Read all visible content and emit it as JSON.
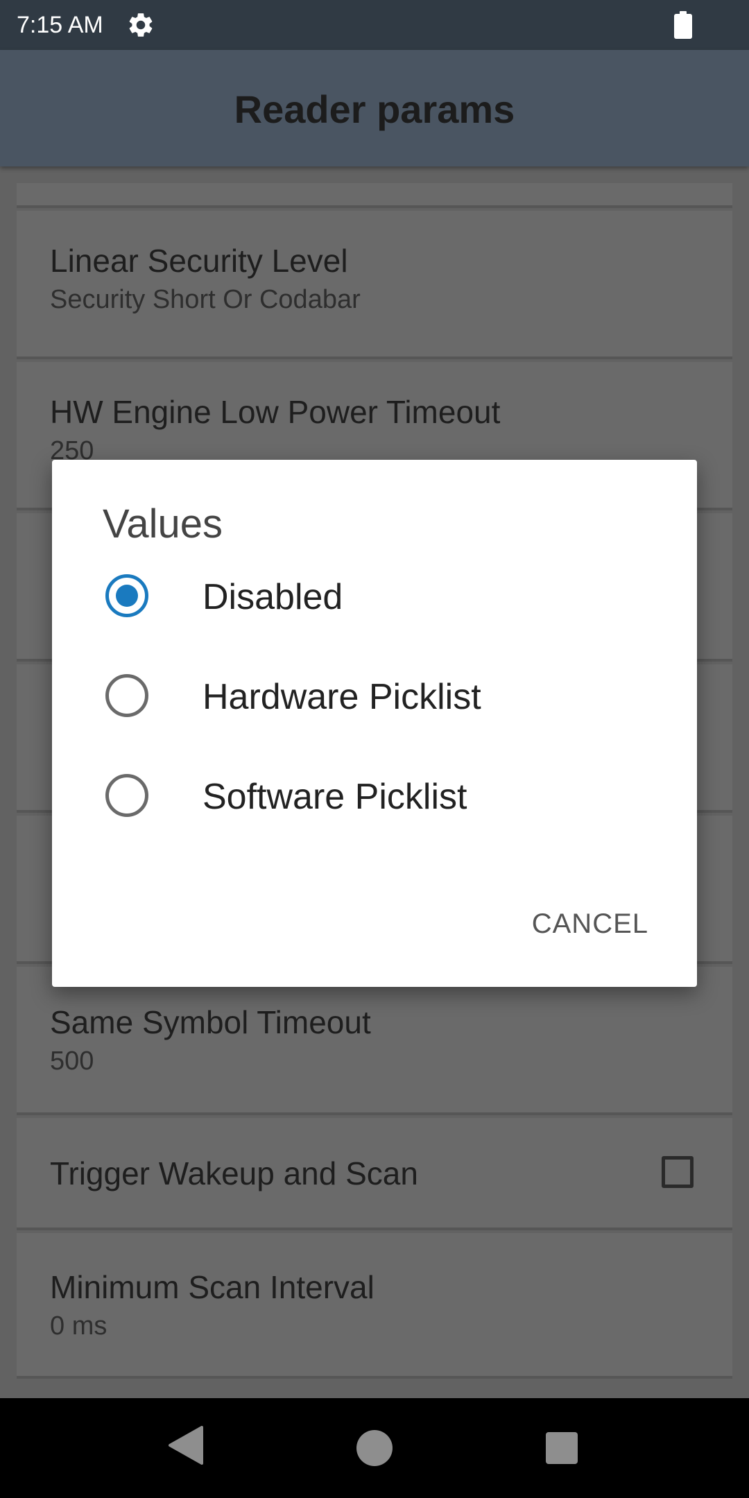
{
  "status_bar": {
    "time": "7:15 AM",
    "icons": [
      "gear-icon",
      "battery-icon"
    ]
  },
  "app_bar": {
    "title": "Reader params"
  },
  "list": {
    "items": [
      {
        "title": "Linear Security Level",
        "subtitle": "Security Short Or Codabar"
      },
      {
        "title": "HW Engine Low Power Timeout",
        "subtitle": "250"
      },
      {
        "title": "Same Symbol Timeout",
        "subtitle": "500"
      },
      {
        "title": "Trigger Wakeup and Scan",
        "checked": false
      },
      {
        "title": "Minimum Scan Interval",
        "subtitle": "0 ms"
      }
    ]
  },
  "dialog": {
    "title": "Values",
    "options": [
      {
        "label": "Disabled",
        "selected": true
      },
      {
        "label": "Hardware Picklist",
        "selected": false
      },
      {
        "label": "Software Picklist",
        "selected": false
      }
    ],
    "cancel_label": "CANCEL"
  },
  "nav_bar": {
    "icons": [
      "back-icon",
      "home-icon",
      "recents-icon"
    ]
  },
  "colors": {
    "accent": "#1A7ABF",
    "status_bar": "#303A44",
    "app_bar": "#4A5562",
    "scrim_background": "#666666"
  }
}
